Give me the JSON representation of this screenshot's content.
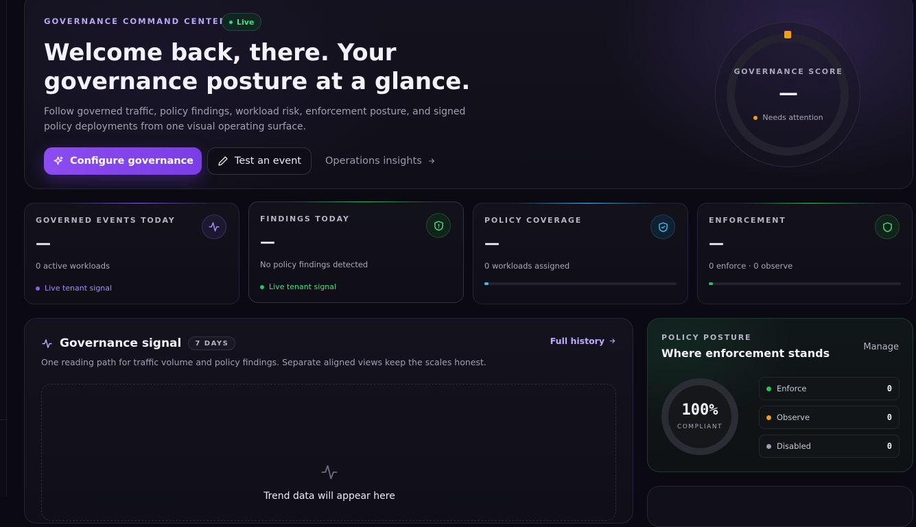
{
  "hero": {
    "eyebrow": "GOVERNANCE COMMAND CENTER",
    "live_label": "Live",
    "title": "Welcome back, there. Your governance posture at a glance.",
    "description": "Follow governed traffic, policy findings, workload risk, enforcement posture, and signed policy deployments from one visual operating surface.",
    "primary_button": "Configure governance",
    "secondary_button": "Test an event",
    "ops_link": "Operations insights",
    "score": {
      "label": "GOVERNANCE SCORE",
      "value": "—",
      "status": "Needs attention",
      "status_color": "#f59e0b"
    }
  },
  "stats": [
    {
      "label": "GOVERNED EVENTS TODAY",
      "value": "—",
      "sub": "0 active workloads",
      "signal": "Live tenant signal",
      "accent": "#8b5cf6",
      "icon": "activity-icon"
    },
    {
      "label": "FINDINGS TODAY",
      "value": "—",
      "sub": "No policy findings detected",
      "signal": "Live tenant signal",
      "accent": "#22c55e",
      "icon": "shield-alert-icon"
    },
    {
      "label": "POLICY COVERAGE",
      "value": "—",
      "sub": "0 workloads assigned",
      "progress": 0.02,
      "accent": "#38bdf8",
      "icon": "shield-check-icon"
    },
    {
      "label": "ENFORCEMENT",
      "value": "—",
      "sub": "0 enforce · 0 observe",
      "progress": 0.02,
      "accent": "#22c55e",
      "icon": "shield-icon"
    }
  ],
  "signal_panel": {
    "title": "Governance signal",
    "badge": "7 DAYS",
    "history_link": "Full history",
    "description": "One reading path for traffic volume and policy findings. Separate aligned views keep the scales honest.",
    "empty_text": "Trend data will appear here"
  },
  "posture": {
    "eyebrow": "POLICY POSTURE",
    "title": "Where enforcement stands",
    "manage": "Manage",
    "percent": "100%",
    "caption": "COMPLIANT",
    "modes": [
      {
        "name": "Enforce",
        "count": "0",
        "color": "#22c55e"
      },
      {
        "name": "Observe",
        "count": "0",
        "color": "#f59e0b"
      },
      {
        "name": "Disabled",
        "count": "0",
        "color": "#94a3b8"
      }
    ]
  }
}
